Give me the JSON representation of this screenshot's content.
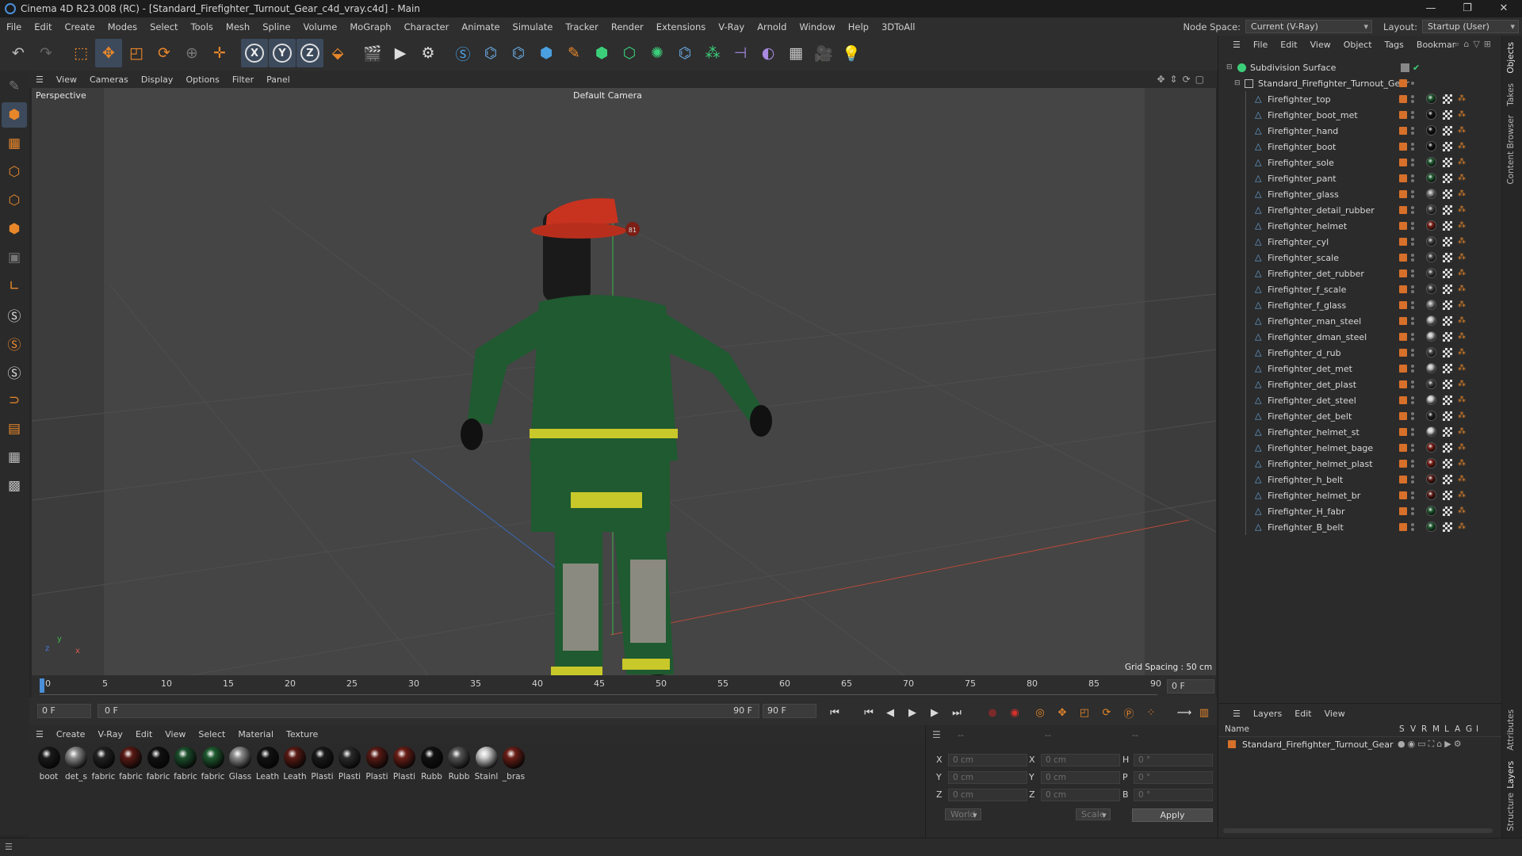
{
  "window": {
    "title": "Cinema 4D R23.008 (RC) - [Standard_Firefighter_Turnout_Gear_c4d_vray.c4d] - Main",
    "controls": [
      "—",
      "❐",
      "✕"
    ]
  },
  "menubar": {
    "items": [
      "File",
      "Edit",
      "Create",
      "Modes",
      "Select",
      "Tools",
      "Mesh",
      "Spline",
      "Volume",
      "MoGraph",
      "Character",
      "Animate",
      "Simulate",
      "Tracker",
      "Render",
      "Extensions",
      "V-Ray",
      "Arnold",
      "Window",
      "Help",
      "3DToAll"
    ],
    "node_space_label": "Node Space:",
    "node_space_value": "Current (V-Ray)",
    "layout_label": "Layout:",
    "layout_value": "Startup (User)"
  },
  "toolbar": {
    "icons": [
      "undo-icon",
      "redo-icon",
      "live-selection-icon",
      "move-icon",
      "scale-icon",
      "rotate-icon",
      "null-icon",
      "recent-tool-icon",
      "x-axis-icon",
      "y-axis-icon",
      "z-axis-icon",
      "coordinate-system-icon",
      "render-view-icon",
      "render-picture-viewer-icon",
      "render-settings-icon",
      "vray-icon",
      "python-icon",
      "python2-icon",
      "cube-icon",
      "pen-icon",
      "generator-icon",
      "extrude-icon",
      "mograph-cloner-icon",
      "python3-icon",
      "deformer-icon",
      "floor-icon",
      "sky-icon",
      "grid-icon",
      "camera-icon",
      "light-icon"
    ],
    "axis_labels": [
      "X",
      "Y",
      "Z"
    ]
  },
  "viewport": {
    "menu": [
      "View",
      "Cameras",
      "Display",
      "Options",
      "Filter",
      "Panel"
    ],
    "name": "Perspective",
    "camera": "Default Camera",
    "grid_spacing": "Grid Spacing : 50 cm",
    "axis": {
      "y": "y",
      "z": "z",
      "x": "x"
    },
    "helmet_badge": "81"
  },
  "timeline": {
    "ticks": [
      "0",
      "5",
      "10",
      "15",
      "20",
      "25",
      "30",
      "35",
      "40",
      "45",
      "50",
      "55",
      "60",
      "65",
      "70",
      "75",
      "80",
      "85",
      "90"
    ],
    "end_field": "0 F"
  },
  "transport": {
    "current_frame": "0 F",
    "range_start": "0 F",
    "range_end": "90 F",
    "max_frame": "90 F"
  },
  "material_manager": {
    "menu": [
      "Create",
      "V-Ray",
      "Edit",
      "View",
      "Select",
      "Material",
      "Texture"
    ],
    "materials": [
      {
        "name": "boot",
        "color": "#1a1a1a"
      },
      {
        "name": "det_s",
        "color": "#8a8a8a"
      },
      {
        "name": "fabric",
        "color": "#222222"
      },
      {
        "name": "fabric",
        "color": "#5a1a14"
      },
      {
        "name": "fabric",
        "color": "#111111"
      },
      {
        "name": "fabric",
        "color": "#1b4f2c"
      },
      {
        "name": "fabric",
        "color": "#1e5a30"
      },
      {
        "name": "Glass",
        "color": "#8c8c8c"
      },
      {
        "name": "Leath",
        "color": "#111111"
      },
      {
        "name": "Leath",
        "color": "#5a1a14"
      },
      {
        "name": "Plasti",
        "color": "#1a1a1a"
      },
      {
        "name": "Plasti",
        "color": "#2a2a2a"
      },
      {
        "name": "Plasti",
        "color": "#5a1a14"
      },
      {
        "name": "Plasti",
        "color": "#6a1e16"
      },
      {
        "name": "Rubb",
        "color": "#111111"
      },
      {
        "name": "Rubb",
        "color": "#555555"
      },
      {
        "name": "Stainl",
        "color": "#cccccc"
      },
      {
        "name": "_bras",
        "color": "#6a1e16"
      }
    ]
  },
  "attributes": {
    "header": "--",
    "rows": [
      {
        "a": "X",
        "av": "0 cm",
        "b": "X",
        "bv": "0 cm",
        "c": "H",
        "cv": "0 °"
      },
      {
        "a": "Y",
        "av": "0 cm",
        "b": "Y",
        "bv": "0 cm",
        "c": "P",
        "cv": "0 °"
      },
      {
        "a": "Z",
        "av": "0 cm",
        "b": "Z",
        "bv": "0 cm",
        "c": "B",
        "cv": "0 °"
      }
    ],
    "world": "World",
    "scale": "Scale",
    "apply": "Apply"
  },
  "object_manager": {
    "menu": [
      "File",
      "Edit",
      "View",
      "Object",
      "Tags",
      "Bookmar"
    ],
    "root": "Subdivision Surface",
    "group": "Standard_Firefighter_Turnout_Gear",
    "objects": [
      {
        "name": "Firefighter_top",
        "mat": "#1e5a30"
      },
      {
        "name": "Firefighter_boot_met",
        "mat": "#111111"
      },
      {
        "name": "Firefighter_hand",
        "mat": "#111111"
      },
      {
        "name": "Firefighter_boot",
        "mat": "#111111"
      },
      {
        "name": "Firefighter_sole",
        "mat": "#1e5a30"
      },
      {
        "name": "Firefighter_pant",
        "mat": "#1e5a30"
      },
      {
        "name": "Firefighter_glass",
        "mat": "#8c8c8c"
      },
      {
        "name": "Firefighter_detail_rubber",
        "mat": "#444444"
      },
      {
        "name": "Firefighter_helmet",
        "mat": "#7a1e16"
      },
      {
        "name": "Firefighter_cyl",
        "mat": "#444444"
      },
      {
        "name": "Firefighter_scale",
        "mat": "#444444"
      },
      {
        "name": "Firefighter_det_rubber",
        "mat": "#444444"
      },
      {
        "name": "Firefighter_f_scale",
        "mat": "#444444"
      },
      {
        "name": "Firefighter_f_glass",
        "mat": "#8c8c8c"
      },
      {
        "name": "Firefighter_man_steel",
        "mat": "#bbbbbb"
      },
      {
        "name": "Firefighter_dman_steel",
        "mat": "#bbbbbb"
      },
      {
        "name": "Firefighter_d_rub",
        "mat": "#444444"
      },
      {
        "name": "Firefighter_det_met",
        "mat": "#bbbbbb"
      },
      {
        "name": "Firefighter_det_plast",
        "mat": "#444444"
      },
      {
        "name": "Firefighter_det_steel",
        "mat": "#cccccc"
      },
      {
        "name": "Firefighter_det_belt",
        "mat": "#222222"
      },
      {
        "name": "Firefighter_helmet_st",
        "mat": "#cccccc"
      },
      {
        "name": "Firefighter_helmet_bage",
        "mat": "#7a1e16"
      },
      {
        "name": "Firefighter_helmet_plast",
        "mat": "#7a1e16"
      },
      {
        "name": "Firefighter_h_belt",
        "mat": "#5a1a14"
      },
      {
        "name": "Firefighter_helmet_br",
        "mat": "#5a1a14"
      },
      {
        "name": "Firefighter_H_fabr",
        "mat": "#1e5a30"
      },
      {
        "name": "Firefighter_B_belt",
        "mat": "#1e5a30"
      }
    ]
  },
  "layers": {
    "menu": [
      "Layers",
      "Edit",
      "View"
    ],
    "header_name": "Name",
    "header_cols": [
      "S",
      "V",
      "R",
      "M",
      "L",
      "A",
      "G",
      "I"
    ],
    "items": [
      "Standard_Firefighter_Turnout_Gear"
    ]
  },
  "side_tabs": [
    "Objects",
    "Takes",
    "Content Browser",
    "Attributes",
    "Layers",
    "Structure"
  ],
  "colors": {
    "accent_orange": "#d7702a",
    "ui_bg": "#2b2b2b",
    "viewport_bg": "#454545",
    "timeline_blue": "#4a8fd8"
  }
}
